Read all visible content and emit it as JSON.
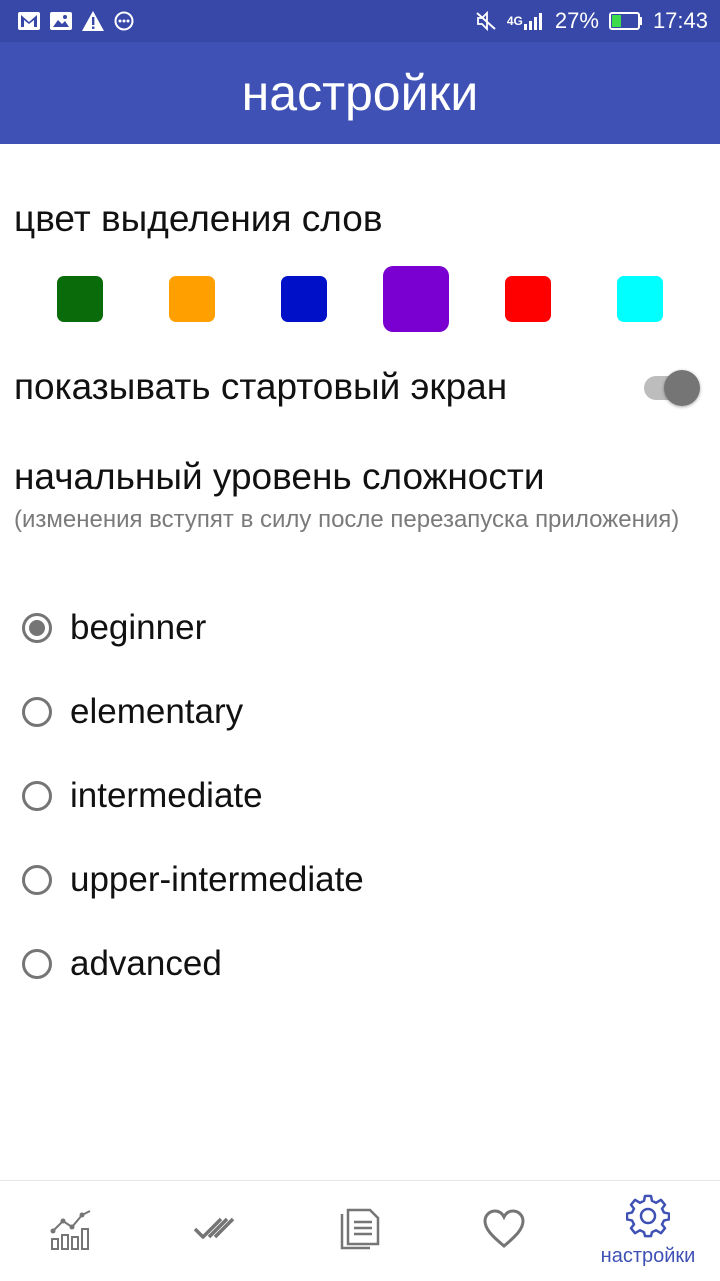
{
  "status_bar": {
    "left_icons": [
      "gmail-icon",
      "image-icon",
      "warning-icon",
      "more-icon"
    ],
    "network": "4G",
    "battery": "27%",
    "time": "17:43"
  },
  "app_bar": {
    "title": "настройки"
  },
  "highlight": {
    "title": "цвет выделения слов",
    "colors": [
      "#0a6b0a",
      "#ff9f00",
      "#0010c8",
      "#7a00d1",
      "#ff0000",
      "#00ffff"
    ],
    "selected_index": 3
  },
  "start_screen": {
    "label": "показывать стартовый экран",
    "enabled": true
  },
  "difficulty": {
    "title": "начальный уровень сложности",
    "note": "(изменения вступят в силу после перезапуска приложения)",
    "options": [
      "beginner",
      "elementary",
      "intermediate",
      "upper-intermediate",
      "advanced"
    ],
    "selected_index": 0
  },
  "bottom_nav": {
    "items": [
      {
        "icon": "statistics-icon",
        "label": ""
      },
      {
        "icon": "done-all-icon",
        "label": ""
      },
      {
        "icon": "documents-icon",
        "label": ""
      },
      {
        "icon": "heart-icon",
        "label": ""
      },
      {
        "icon": "gear-icon",
        "label": "настройки"
      }
    ],
    "active_index": 4,
    "active_color": "#3f51b5",
    "inactive_color": "#757575"
  }
}
